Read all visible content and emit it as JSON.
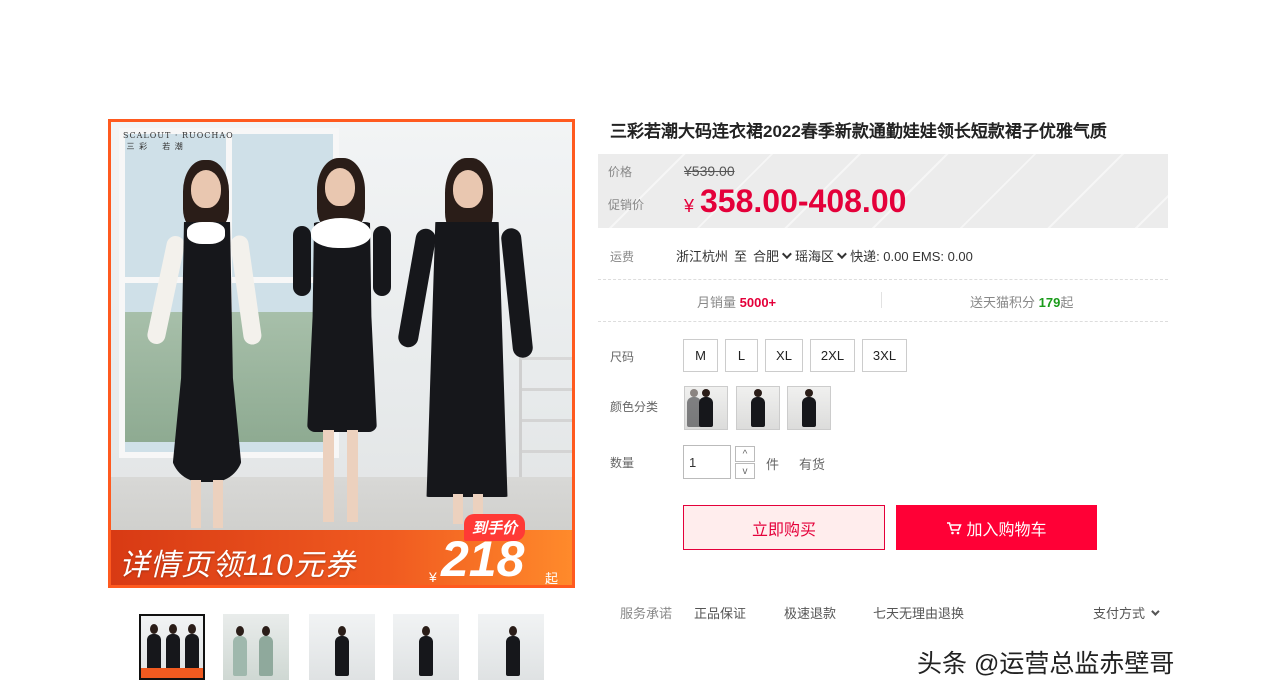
{
  "product": {
    "title": "三彩若潮大码连衣裙2022春季新款通勤娃娃领长短款裙子优雅气质"
  },
  "main_image": {
    "brand_logo": "SCALOUT · RUOCHAO\n 三 彩    若 潮",
    "promo_text": "详情页领110元券",
    "promo_tag": "到手价",
    "promo_currency": "¥",
    "promo_price": "218",
    "promo_suffix": "起"
  },
  "price": {
    "label_price": "价格",
    "original_price": "¥539.00",
    "label_promo": "促销价",
    "currency": "¥",
    "promo_price": "358.00-408.00"
  },
  "shipping": {
    "label": "运费",
    "from": "浙江杭州",
    "to_word": "至",
    "city": "合肥",
    "district": "瑶海区",
    "fees": "快递: 0.00 EMS: 0.00"
  },
  "stats": {
    "sales_label": "月销量",
    "sales_value": "5000+",
    "points_label": "送天猫积分",
    "points_value": "179",
    "points_suffix": "起"
  },
  "size": {
    "label": "尺码",
    "options": [
      "M",
      "L",
      "XL",
      "2XL",
      "3XL"
    ]
  },
  "color": {
    "label": "颜色分类"
  },
  "quantity": {
    "label": "数量",
    "value": "1",
    "unit": "件",
    "stock": "有货",
    "up": "^",
    "down": "v"
  },
  "actions": {
    "buy_now": "立即购买",
    "add_to_cart": "加入购物车"
  },
  "services": {
    "label": "服务承诺",
    "items": [
      "正品保证",
      "极速退款",
      "七天无理由退换"
    ],
    "payment": "支付方式"
  },
  "watermark": "头条 @运营总监赤壁哥",
  "colors": {
    "accent": "#ff0036",
    "price_red": "#e4003a",
    "promo_orange": "#ff5a1f",
    "points_green": "#1a9b1a"
  }
}
